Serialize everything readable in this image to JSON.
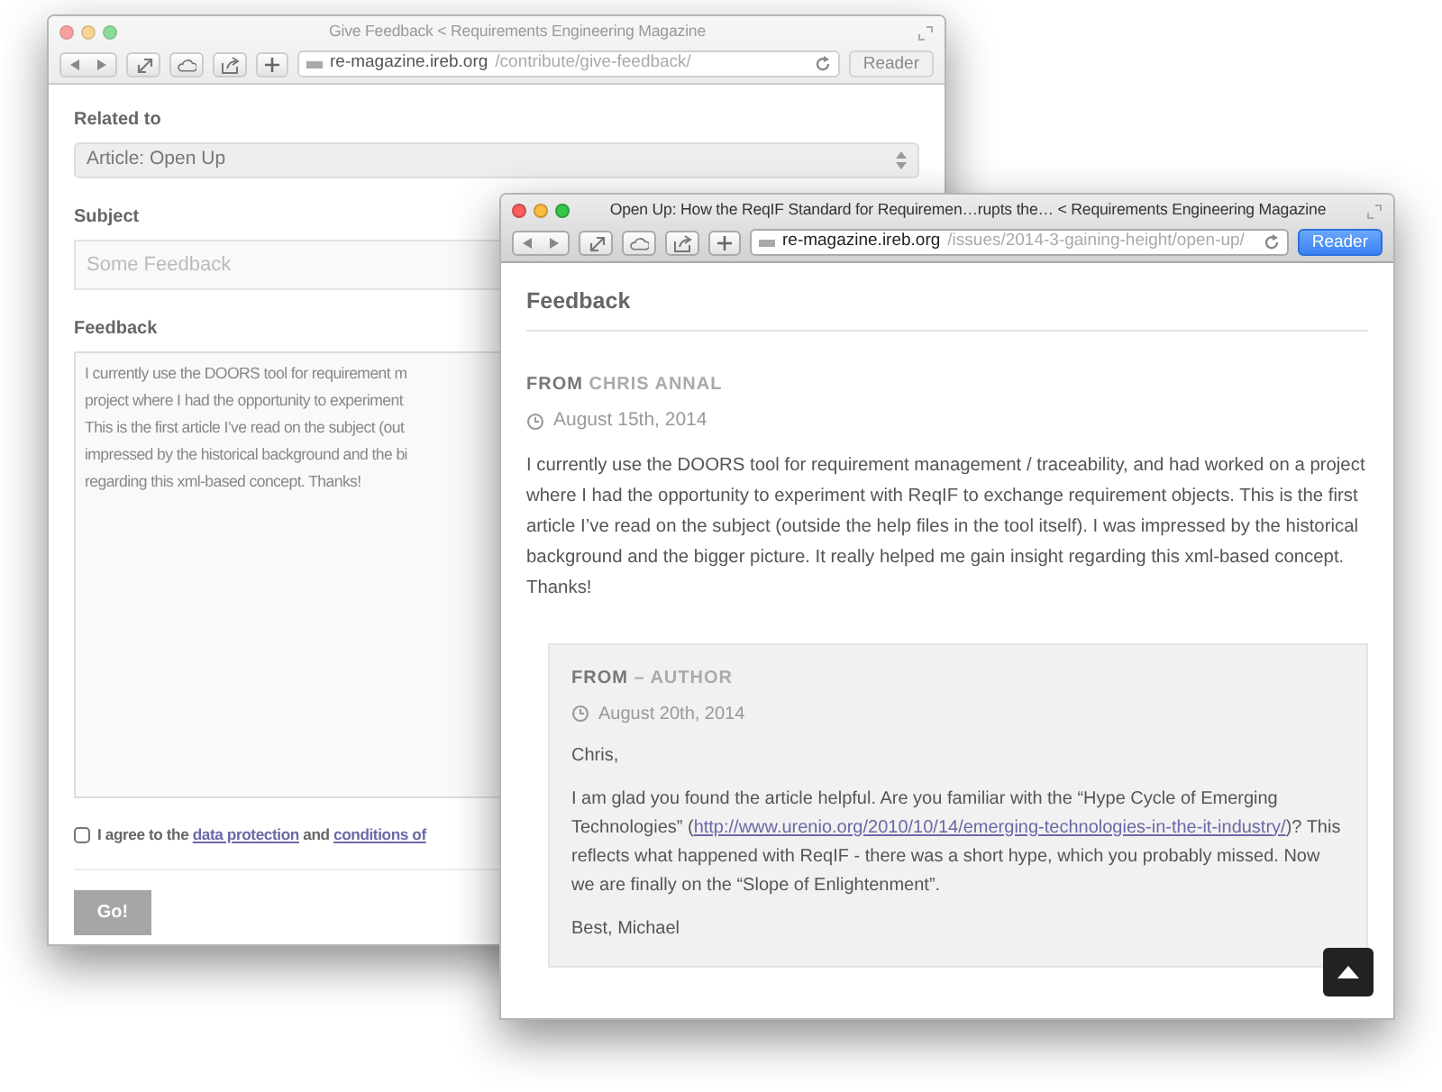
{
  "windows": [
    {
      "title": "Give Feedback < Requirements Engineering Magazine",
      "focused": false,
      "address": {
        "host": "re-magazine.ireb.org",
        "path": "/contribute/give-feedback/"
      },
      "reader": {
        "label": "Reader",
        "enabled": false
      },
      "page": {
        "kind": "form",
        "related": {
          "label": "Related to",
          "value": "Article: Open Up"
        },
        "subject": {
          "label": "Subject",
          "placeholder": "Some Feedback"
        },
        "feedback": {
          "label": "Feedback",
          "lines": [
            "I currently use the DOORS tool for requirement m",
            "project where I had the opportunity to experiment",
            "This is the first article I’ve read on the subject (out",
            "impressed by the historical background and the bi",
            "regarding this xml-based concept. Thanks!"
          ]
        },
        "agreement": {
          "checked": false,
          "text": "I agree to the",
          "link_1": "data protection",
          "joiner": "and",
          "link_2": "conditions of"
        },
        "submit": "Go!"
      }
    },
    {
      "title": "Open Up: How the ReqIF Standard for Requiremen…rupts the… < Requirements Engineering Magazine",
      "focused": true,
      "address": {
        "host": "re-magazine.ireb.org",
        "path": "/issues/2014-3-gaining-height/open-up/"
      },
      "reader": {
        "label": "Reader",
        "enabled": true
      },
      "page": {
        "kind": "feedback",
        "heading": "Feedback",
        "comment": {
          "from": "FROM",
          "author": "CHRIS ANNAL",
          "date": "August 15th, 2014",
          "text": "I currently use the DOORS tool for requirement management / traceability, and had worked on a project where I had the opportunity to experiment with ReqIF to exchange requirement objects. This is the first article I’ve read on the subject (outside the help files in the tool itself). I was impressed by the historical background and the bigger picture. It really helped me gain insight regarding this xml-based concept. Thanks!"
        },
        "reply": {
          "from": "FROM",
          "author": "– AUTHOR",
          "date": "August 20th, 2014",
          "greeting": "Chris,",
          "body": {
            "before": "I am glad you found the article helpful. Are you familiar with the “Hype Cycle of Emerging Technologies” (",
            "link": "http://www.urenio.org/2010/10/14/emerging-technologies-in-the-it-industry/",
            "after": ")? This reflects what happened with ReqIF - there was a short hype, which you probably missed. Now we are finally on the “Slope of Enlightenment”."
          },
          "closing": "Best, Michael"
        },
        "scroll_top": true
      }
    }
  ]
}
